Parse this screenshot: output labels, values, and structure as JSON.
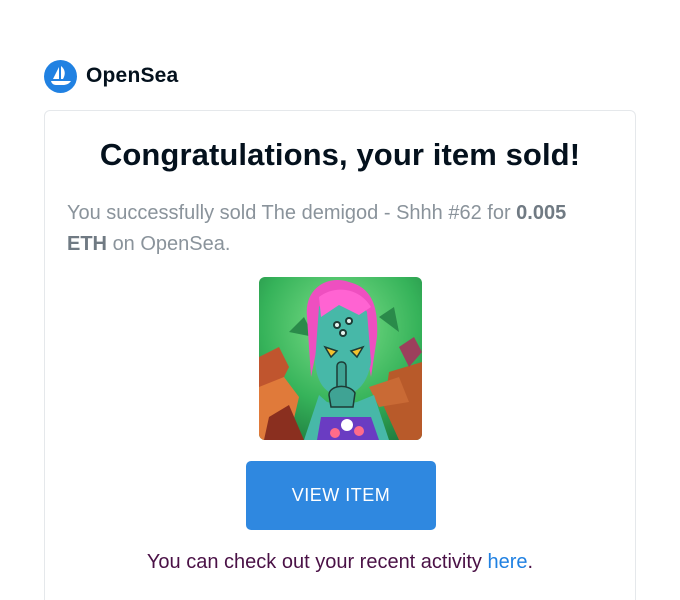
{
  "brand": {
    "name": "OpenSea",
    "logo_icon": "opensea-sailboat-icon",
    "accent_color": "#2081e2"
  },
  "email": {
    "title": "Congratulations, your item sold!",
    "message_prefix": "You successfully sold The demigod - Shhh #62 for",
    "amount": "0.005 ETH",
    "message_suffix": "on OpenSea.",
    "item_image": "nft-artwork-demigod-shhh-62",
    "view_button_label": "VIEW ITEM",
    "footer_prefix": "You can check out your recent activity",
    "footer_link": "here",
    "footer_suffix": "."
  }
}
